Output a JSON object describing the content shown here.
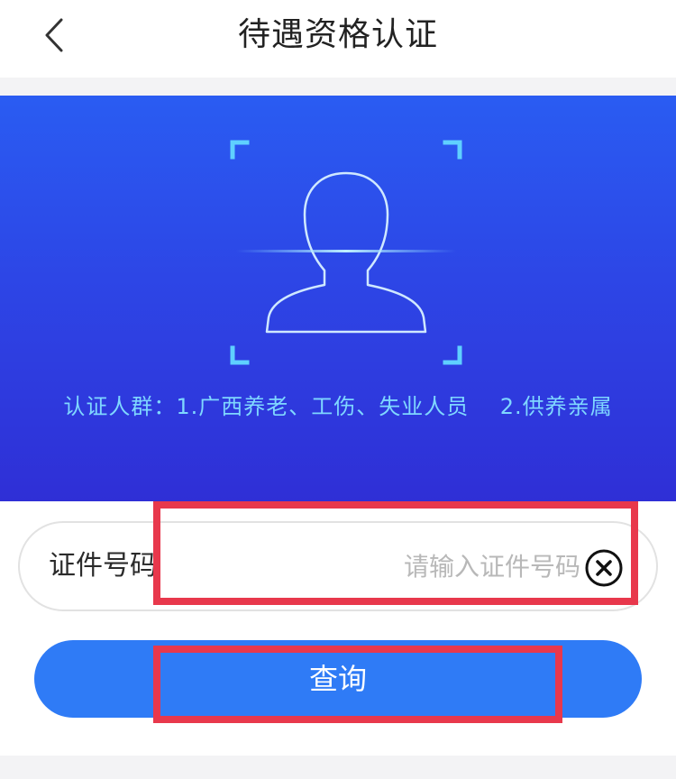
{
  "header": {
    "title": "待遇资格认证",
    "back_icon": "chevron-left-icon"
  },
  "banner": {
    "caption": "认证人群：1.广西养老、工伤、失业人员    2.供养亲属",
    "icon": "face-scan-icon",
    "colors": {
      "background": "#2d46e6",
      "line": "#7fd7ff"
    }
  },
  "form": {
    "id_label": "证件号码",
    "id_placeholder": "请输入证件号码",
    "id_value": "",
    "clear_icon": "clear-circle-icon",
    "query_label": "查询"
  },
  "colors": {
    "accent": "#2f7bf6",
    "highlight": "#e8384c"
  }
}
